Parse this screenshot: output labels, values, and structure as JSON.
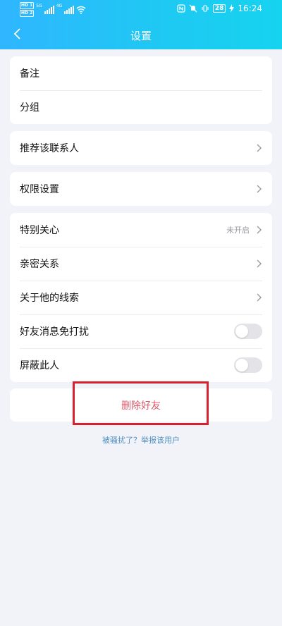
{
  "status_bar": {
    "hd1": "HD 1",
    "hd2": "HD 2",
    "net1": "5G",
    "net2": "4G",
    "battery": "28",
    "time": "16:24"
  },
  "header": {
    "title": "设置",
    "gradient": [
      "#2fb6ff",
      "#16d3ef"
    ]
  },
  "groups": [
    {
      "items": [
        {
          "label": "备注"
        },
        {
          "label": "分组"
        }
      ]
    },
    {
      "items": [
        {
          "label": "推荐该联系人",
          "icon": "chevron-right-icon"
        }
      ]
    },
    {
      "items": [
        {
          "label": "权限设置",
          "icon": "chevron-right-icon"
        }
      ]
    },
    {
      "items": [
        {
          "label": "特别关心",
          "value": "未开启",
          "icon": "chevron-right-icon"
        },
        {
          "label": "亲密关系",
          "icon": "chevron-right-icon"
        },
        {
          "label": "关于他的线索",
          "icon": "chevron-right-icon"
        },
        {
          "label": "好友消息免打扰",
          "toggle": false
        },
        {
          "label": "屏蔽此人",
          "toggle": false
        }
      ]
    }
  ],
  "delete_button": "删除好友",
  "report_link": "被骚扰了？举报该用户",
  "colors": {
    "delete_text": "#e05a6b",
    "highlight_border": "#d72030",
    "link": "#4c8ec4"
  }
}
